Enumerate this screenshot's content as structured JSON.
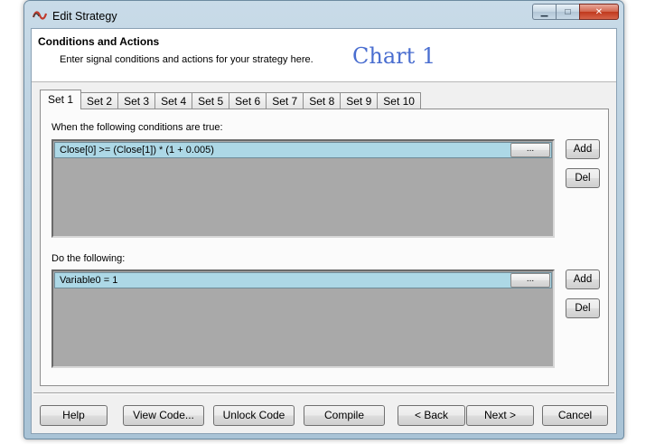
{
  "window": {
    "title": "Edit Strategy",
    "controls": {
      "minimize": "▁",
      "maximize": "□",
      "close": "✕"
    }
  },
  "header": {
    "title": "Conditions and Actions",
    "subtitle": "Enter signal conditions and actions for your strategy here.",
    "chart_label": "Chart 1"
  },
  "tabs": [
    "Set 1",
    "Set 2",
    "Set 3",
    "Set 4",
    "Set 5",
    "Set 6",
    "Set 7",
    "Set 8",
    "Set 9",
    "Set 10"
  ],
  "active_tab": "Set 1",
  "conditions": {
    "label": "When the following conditions are true:",
    "rows": [
      {
        "text": "Close[0] >= (Close[1]) * (1 + 0.005)",
        "button": "..."
      }
    ],
    "add_label": "Add",
    "del_label": "Del"
  },
  "actions": {
    "label": "Do the following:",
    "rows": [
      {
        "text": "Variable0 = 1",
        "button": "..."
      }
    ],
    "add_label": "Add",
    "del_label": "Del"
  },
  "footer": {
    "help": "Help",
    "view_code": "View Code...",
    "unlock_code": "Unlock Code",
    "compile": "Compile",
    "back": "< Back",
    "next": "Next >",
    "cancel": "Cancel"
  },
  "colors": {
    "selected_row": "#add8e6",
    "list_background": "#a9a9a9",
    "chart_label": "#4a6ed0",
    "title_bar": "#b8cfdf"
  }
}
